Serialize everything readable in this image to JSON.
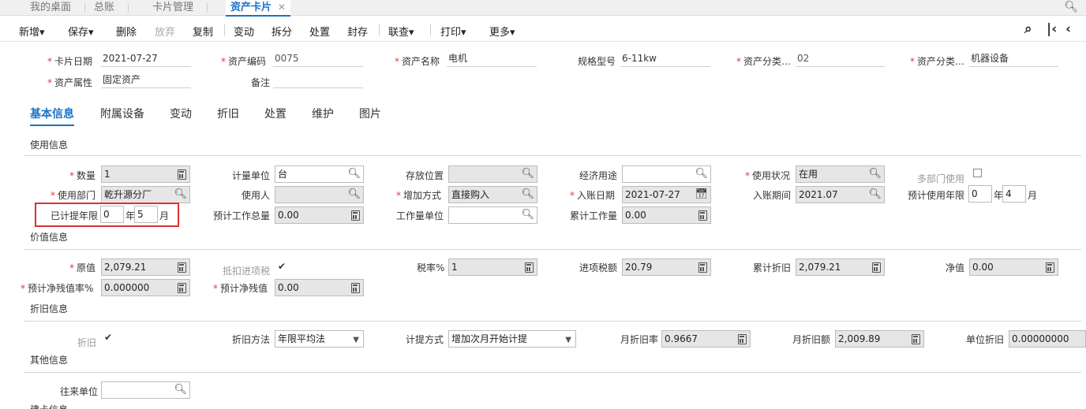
{
  "tabs": [
    {
      "label": "我的桌面"
    },
    {
      "label": "总账"
    },
    {
      "label": "卡片管理"
    },
    {
      "label": "资产卡片",
      "active": true
    }
  ],
  "toolbar": {
    "new": "新增",
    "save": "保存",
    "delete": "删除",
    "discard": "放弃",
    "copy": "复制",
    "change": "变动",
    "split": "拆分",
    "dispose": "处置",
    "seal": "封存",
    "link": "联查",
    "print": "打印",
    "more": "更多"
  },
  "header": {
    "card_date_label": "卡片日期",
    "card_date": "2021-07-27",
    "asset_code_label": "资产编码",
    "asset_code": "0075",
    "asset_name_label": "资产名称",
    "asset_name": "电机",
    "spec_label": "规格型号",
    "spec": "6-11kw",
    "category_code_label": "资产分类…",
    "category_code": "02",
    "category_name_label": "资产分类…",
    "category_name": "机器设备",
    "attr_label": "资产属性",
    "attr": "固定资产",
    "note_label": "备注",
    "note": ""
  },
  "subtabs": [
    "基本信息",
    "附属设备",
    "变动",
    "折旧",
    "处置",
    "维护",
    "图片"
  ],
  "sections": {
    "usage": "使用信息",
    "value": "价值信息",
    "depreciation": "折旧信息",
    "other": "其他信息",
    "build": "建卡信息"
  },
  "usage": {
    "qty_label": "数量",
    "qty": "1",
    "unit_label": "计量单位",
    "unit": "台",
    "location_label": "存放位置",
    "location": "",
    "econ_label": "经济用途",
    "econ": "",
    "status_label": "使用状况",
    "status": "在用",
    "multi_dept_label": "多部门使用",
    "dept_label": "使用部门",
    "dept": "乾升源分厂",
    "user_label": "使用人",
    "user": "",
    "add_method_label": "增加方式",
    "add_method": "直接购入",
    "entry_date_label": "入账日期",
    "entry_date": "2021-07-27",
    "entry_period_label": "入账期间",
    "entry_period": "2021.07",
    "life_label": "预计使用年限",
    "life_years": "0",
    "life_months": "4",
    "accrued_label": "已计提年限",
    "accrued_years": "0",
    "accrued_months": "5",
    "year_unit": "年",
    "month_unit": "月",
    "total_work_label": "预计工作总量",
    "total_work": "0.00",
    "work_unit_label": "工作量单位",
    "work_unit": "",
    "acc_work_label": "累计工作量",
    "acc_work": "0.00"
  },
  "value": {
    "orig_label": "原值",
    "orig": "2,079.21",
    "deduct_tax_label": "抵扣进项税",
    "tax_rate_label": "税率%",
    "tax_rate": "1",
    "input_tax_label": "进项税额",
    "input_tax": "20.79",
    "acc_dep_label": "累计折旧",
    "acc_dep": "2,079.21",
    "net_label": "净值",
    "net": "0.00",
    "residual_rate_label": "预计净残值率%",
    "residual_rate": "0.000000",
    "residual_label": "预计净残值",
    "residual": "0.00"
  },
  "depreciation": {
    "dep_label": "折旧",
    "method_label": "折旧方法",
    "method": "年限平均法",
    "accrual_label": "计提方式",
    "accrual": "增加次月开始计提",
    "monthly_rate_label": "月折旧率",
    "monthly_rate": "0.9667",
    "monthly_amount_label": "月折旧额",
    "monthly_amount": "2,009.89",
    "unit_dep_label": "单位折旧",
    "unit_dep": "0.00000000"
  },
  "other": {
    "partner_label": "往来单位",
    "partner": ""
  }
}
